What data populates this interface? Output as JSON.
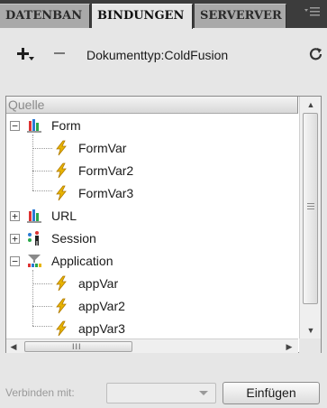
{
  "tabs": [
    {
      "label": "DATENBAN",
      "active": false
    },
    {
      "label": "BINDUNGEN",
      "active": true
    },
    {
      "label": "SERVERVER",
      "active": false
    }
  ],
  "panel_menu_icon": "panel-menu-icon",
  "toolbar": {
    "add_icon": "plus-icon",
    "remove_icon": "minus-icon",
    "document_type": "Dokumenttyp:ColdFusion",
    "refresh_icon": "refresh-icon"
  },
  "tree": {
    "column_header": "Quelle",
    "nodes": [
      {
        "label": "Form",
        "icon": "form-icon",
        "expanded": true,
        "children": [
          "FormVar",
          "FormVar2",
          "FormVar3"
        ]
      },
      {
        "label": "URL",
        "icon": "url-icon",
        "expanded": false
      },
      {
        "label": "Session",
        "icon": "session-icon",
        "expanded": false
      },
      {
        "label": "Application",
        "icon": "application-icon",
        "expanded": true,
        "children": [
          "appVar",
          "appVar2",
          "appVar3"
        ]
      }
    ],
    "variable_icon": "lightning-icon"
  },
  "scrollbar_grip": "III",
  "bottom": {
    "bind_label": "Verbinden mit:",
    "bind_value": "",
    "insert_button": "Einfügen"
  },
  "colors": {
    "tab_bar": "#3c3c3c",
    "panel_background": "#e6e6e6",
    "lightning": "#e8b400"
  }
}
